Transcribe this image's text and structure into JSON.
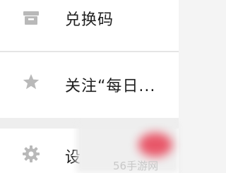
{
  "menu": {
    "items": [
      {
        "icon": "gift-box-icon",
        "label": "兑换码"
      },
      {
        "icon": "star-icon",
        "label": "关注“每日..."
      },
      {
        "icon": "gear-icon",
        "label": "设"
      }
    ]
  },
  "colors": {
    "background": "#f4f4f4",
    "row": "#ffffff",
    "icon": "#b9b9b9",
    "text": "#1e1e1e",
    "divider": "#e5e5e5",
    "watermark": "#c8c8c8",
    "blur_red": "#e8465a"
  },
  "watermark": {
    "text": "56手游网"
  }
}
